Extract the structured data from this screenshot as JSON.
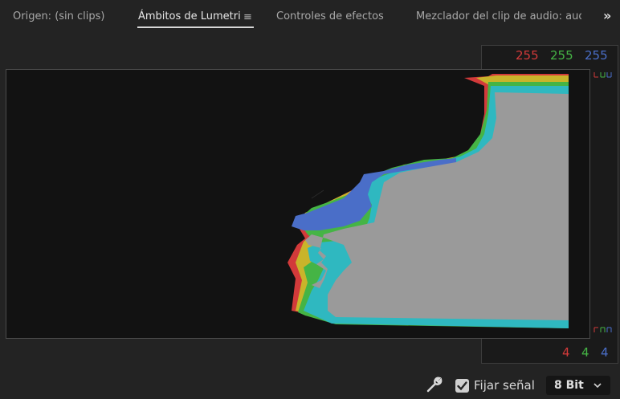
{
  "tabs": [
    {
      "label": "Origen: (sin clips)"
    },
    {
      "label": "Ámbitos de Lumetri"
    },
    {
      "label": "Controles de efectos"
    },
    {
      "label": "Mezclador del clip de audio: audio"
    }
  ],
  "scale": {
    "top": {
      "r": "255",
      "g": "255",
      "b": "255"
    },
    "bottom": {
      "r": "4",
      "g": "4",
      "b": "4"
    }
  },
  "footer": {
    "clamp_label": "Fijar señal",
    "clamp_checked": true,
    "bit_depth": "8 Bit"
  },
  "colors": {
    "red": "#d23a3a",
    "green": "#45b445",
    "blue": "#4a6ec8"
  }
}
